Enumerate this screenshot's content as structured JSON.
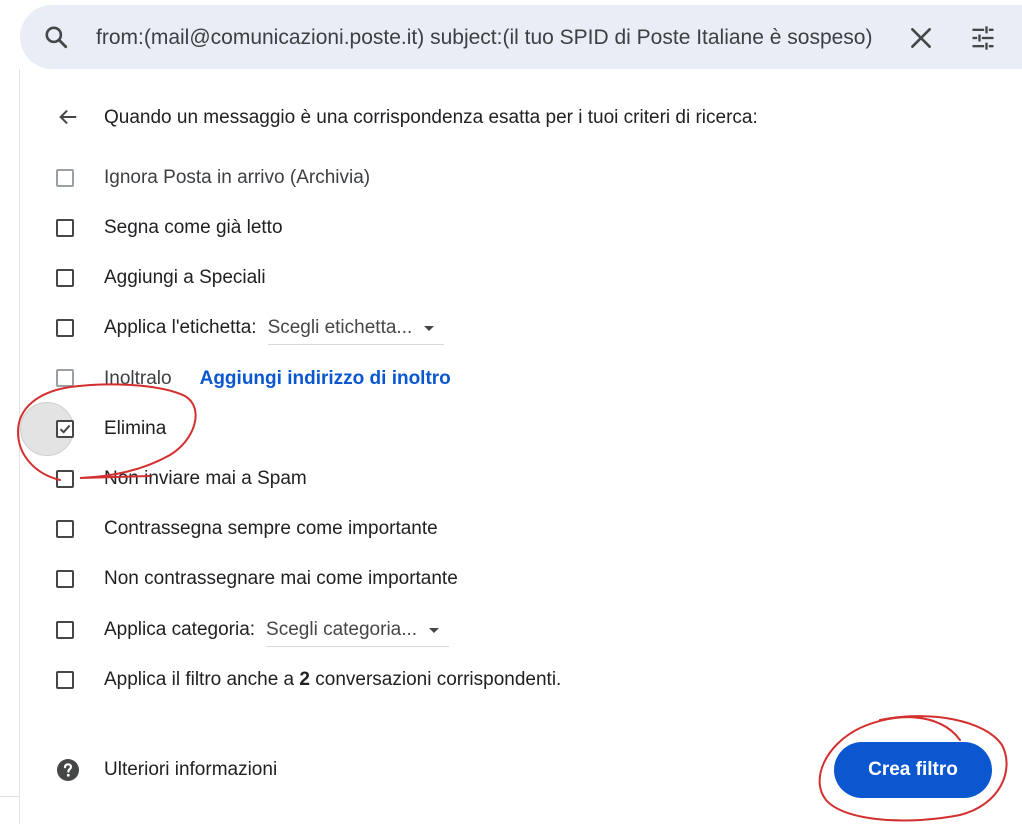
{
  "search": {
    "query": "from:(mail@comunicazioni.poste.it) subject:(il tuo SPID di Poste Italiane è sospeso)"
  },
  "filter": {
    "criteria_text": "Quando un messaggio è una corrispondenza esatta per i tuoi criteri di ricerca:",
    "options": {
      "archive": {
        "label": "Ignora Posta in arrivo (Archivia)",
        "checked": false,
        "disabled": true
      },
      "mark_read": {
        "label": "Segna come già letto",
        "checked": false
      },
      "star": {
        "label": "Aggiungi a Speciali",
        "checked": false
      },
      "label": {
        "label": "Applica l'etichetta:",
        "dropdown": "Scegli etichetta...",
        "checked": false
      },
      "forward": {
        "label": "Inoltralo",
        "link": "Aggiungi indirizzo di inoltro",
        "checked": false,
        "disabled": true
      },
      "delete": {
        "label": "Elimina",
        "checked": true
      },
      "never_spam": {
        "label": "Non inviare mai a Spam",
        "checked": false
      },
      "always_important": {
        "label": "Contrassegna sempre come importante",
        "checked": false
      },
      "never_important": {
        "label": "Non contrassegnare mai come importante",
        "checked": false
      },
      "category": {
        "label": "Applica categoria:",
        "dropdown": "Scegli categoria...",
        "checked": false
      },
      "apply_existing": {
        "prefix": "Applica il filtro anche a ",
        "count": "2",
        "suffix": " conversazioni corrispondenti.",
        "checked": false
      }
    },
    "help_text": "Ulteriori informazioni",
    "create_button": "Crea filtro"
  },
  "colors": {
    "accent": "#0b57d0",
    "search_bg": "#e9eef6",
    "annotation": "#d32f2f"
  }
}
